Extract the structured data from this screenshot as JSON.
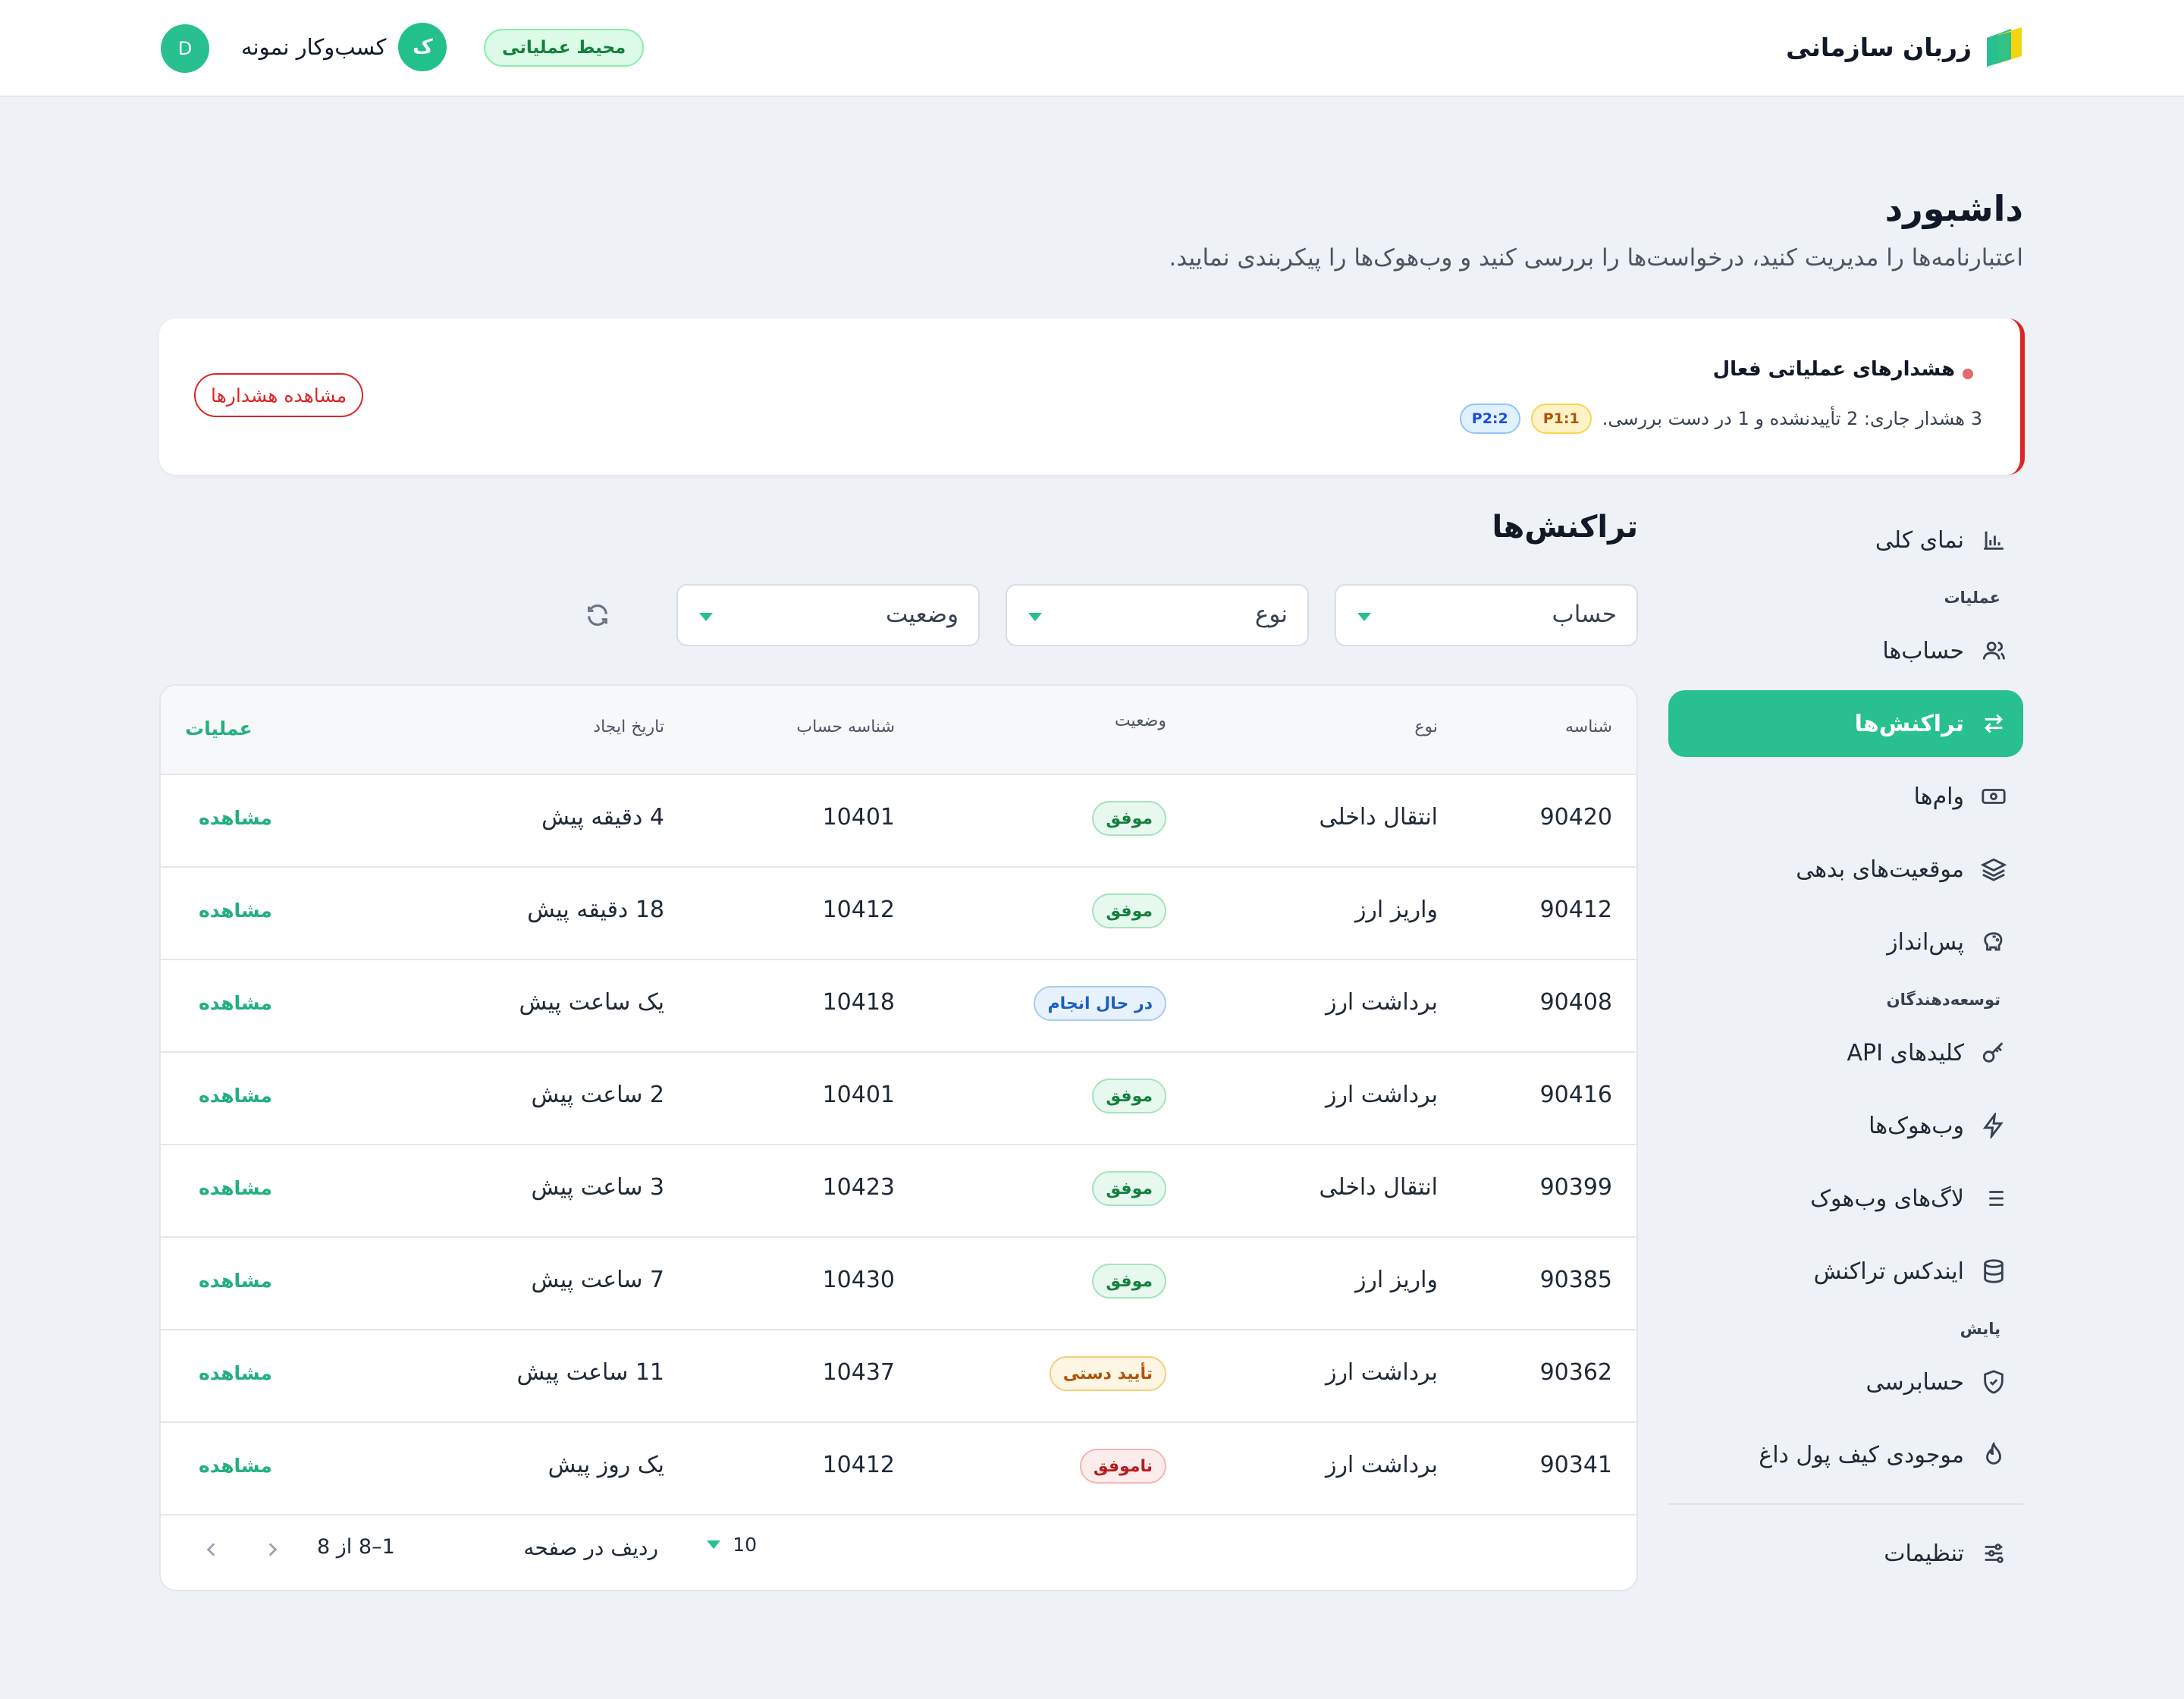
{
  "header": {
    "brand_name": "زربان سازمانی",
    "env_badge": "محیط عملیاتی",
    "business_initial": "ک",
    "business_name": "کسب‌وکار نمونه",
    "user_initial": "D"
  },
  "page": {
    "title": "داشبورد",
    "subtitle": "اعتبارنامه‌ها را مدیریت کنید، درخواست‌ها را بررسی کنید و وب‌هوک‌ها را پیکربندی نمایید."
  },
  "alert": {
    "title": "هشدارهای عملیاتی فعال",
    "description": "3 هشدار جاری: 2 تأییدنشده و 1 در دست بررسی.",
    "p1_badge": "P1:1",
    "p2_badge": "P2:2",
    "button_label": "مشاهده هشدارها"
  },
  "sidebar": {
    "overview": "نمای کلی",
    "section_operations": "عملیات",
    "accounts": "حساب‌ها",
    "transactions": "تراکنش‌ها",
    "loans": "وام‌ها",
    "debt_positions": "موقعیت‌های بدهی",
    "savings": "پس‌انداز",
    "section_developers": "توسعه‌دهندگان",
    "api_keys": "کلیدهای API",
    "webhooks": "وب‌هوک‌ها",
    "webhook_logs": "لاگ‌های وب‌هوک",
    "tx_index": "ایندکس تراکنش",
    "section_monitoring": "پایش",
    "audit": "حسابرسی",
    "hot_wallet": "موجودی کیف پول داغ",
    "settings": "تنظیمات"
  },
  "main": {
    "title": "تراکنش‌ها",
    "filter_account": "حساب",
    "filter_type": "نوع",
    "filter_status": "وضعیت"
  },
  "table": {
    "headers": {
      "id": "شناسه",
      "type": "نوع",
      "status": "وضعیت",
      "account_id": "شناسه حساب",
      "created": "تاریخ ایجاد",
      "actions": "عملیات"
    },
    "rows": [
      {
        "id": "90420",
        "type": "انتقال داخلی",
        "status": "موفق",
        "account": "10401",
        "created": "4 دقیقه پیش",
        "action": "مشاهده"
      },
      {
        "id": "90412",
        "type": "واریز ارز",
        "status": "موفق",
        "account": "10412",
        "created": "18 دقیقه پیش",
        "action": "مشاهده"
      },
      {
        "id": "90408",
        "type": "برداشت ارز",
        "status": "در حال انجام",
        "account": "10418",
        "created": "یک ساعت پیش",
        "action": "مشاهده"
      },
      {
        "id": "90416",
        "type": "برداشت ارز",
        "status": "موفق",
        "account": "10401",
        "created": "2 ساعت پیش",
        "action": "مشاهده"
      },
      {
        "id": "90399",
        "type": "انتقال داخلی",
        "status": "موفق",
        "account": "10423",
        "created": "3 ساعت پیش",
        "action": "مشاهده"
      },
      {
        "id": "90385",
        "type": "واریز ارز",
        "status": "موفق",
        "account": "10430",
        "created": "7 ساعت پیش",
        "action": "مشاهده"
      },
      {
        "id": "90362",
        "type": "برداشت ارز",
        "status": "تأیید دستی",
        "account": "10437",
        "created": "11 ساعت پیش",
        "action": "مشاهده"
      },
      {
        "id": "90341",
        "type": "برداشت ارز",
        "status": "ناموفق",
        "account": "10412",
        "created": "یک روز پیش",
        "action": "مشاهده"
      }
    ],
    "pagination": {
      "rows_per_page_label": "ردیف در صفحه",
      "rows_per_page": "10",
      "range": "1–8 از 8"
    }
  },
  "colors": {
    "accent": "#27c08e",
    "danger": "#dc2626",
    "background": "#eef1f5"
  }
}
